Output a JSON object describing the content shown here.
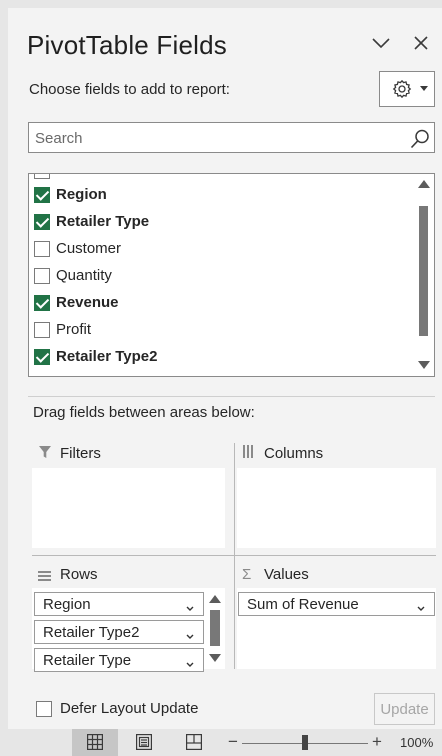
{
  "pane": {
    "title": "PivotTable Fields",
    "choose_label": "Choose fields to add to report:",
    "settings_icon": "gear-icon",
    "search": {
      "placeholder": "Search"
    }
  },
  "fields": [
    {
      "label": "Region",
      "checked": true
    },
    {
      "label": "Retailer Type",
      "checked": true
    },
    {
      "label": "Customer",
      "checked": false
    },
    {
      "label": "Quantity",
      "checked": false
    },
    {
      "label": "Revenue",
      "checked": true
    },
    {
      "label": "Profit",
      "checked": false
    },
    {
      "label": "Retailer Type2",
      "checked": true
    }
  ],
  "areas": {
    "drag_label": "Drag fields between areas below:",
    "filters": {
      "label": "Filters",
      "items": []
    },
    "columns": {
      "label": "Columns",
      "items": []
    },
    "rows": {
      "label": "Rows",
      "items": [
        "Region",
        "Retailer Type2",
        "Retailer Type"
      ]
    },
    "values": {
      "label": "Values",
      "items": [
        "Sum of Revenue"
      ]
    }
  },
  "footer": {
    "defer_label": "Defer Layout Update",
    "defer_checked": false,
    "update_label": "Update"
  },
  "statusbar": {
    "zoom_minus": "−",
    "zoom_plus": "+",
    "zoom_level": "100%"
  },
  "colors": {
    "accent": "#217346"
  }
}
